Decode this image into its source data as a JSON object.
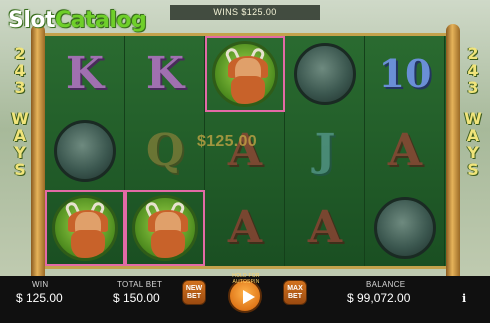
{
  "logo": {
    "slot": "Slot",
    "catalog": "Catalog"
  },
  "wins_banner": "WINS $125.00",
  "ways": {
    "top": [
      "2",
      "4",
      "3"
    ],
    "bottom": [
      "W",
      "A",
      "Y",
      "S"
    ]
  },
  "win_amount": "$125.00",
  "reels": [
    [
      {
        "symbol": "K",
        "kind": "letter",
        "color": "purple"
      },
      {
        "symbol": "",
        "kind": "orb"
      },
      {
        "symbol": "",
        "kind": "hero",
        "win": true
      }
    ],
    [
      {
        "symbol": "K",
        "kind": "letter",
        "color": "purple"
      },
      {
        "symbol": "Q",
        "kind": "letter",
        "color": "gold",
        "dim": true
      },
      {
        "symbol": "",
        "kind": "hero",
        "win": true
      }
    ],
    [
      {
        "symbol": "",
        "kind": "hero",
        "win": true
      },
      {
        "symbol": "A",
        "kind": "letter",
        "color": "red",
        "dim": true
      },
      {
        "symbol": "A",
        "kind": "letter",
        "color": "red",
        "dim": true
      }
    ],
    [
      {
        "symbol": "",
        "kind": "orb"
      },
      {
        "symbol": "J",
        "kind": "letter",
        "color": "teal",
        "dim": true
      },
      {
        "symbol": "A",
        "kind": "letter",
        "color": "red",
        "dim": true
      }
    ],
    [
      {
        "symbol": "10",
        "kind": "letter",
        "color": "blue"
      },
      {
        "symbol": "A",
        "kind": "letter",
        "color": "red",
        "dim": true
      },
      {
        "symbol": "",
        "kind": "orb"
      }
    ]
  ],
  "bottom": {
    "win_label": "WIN",
    "win_value": "$ 125.00",
    "total_bet_label": "TOTAL BET",
    "total_bet_value": "$ 150.00",
    "new_bet_label": "NEW BET",
    "hold_label": "HOLD FOR AUTOSPIN",
    "max_bet_label": "MAX BET",
    "balance_label": "BALANCE",
    "balance_value": "$ 99,072.00",
    "info_label": "i"
  },
  "colors": {
    "win_highlight": "#e36aa6",
    "button_orange": "#d2731f"
  }
}
